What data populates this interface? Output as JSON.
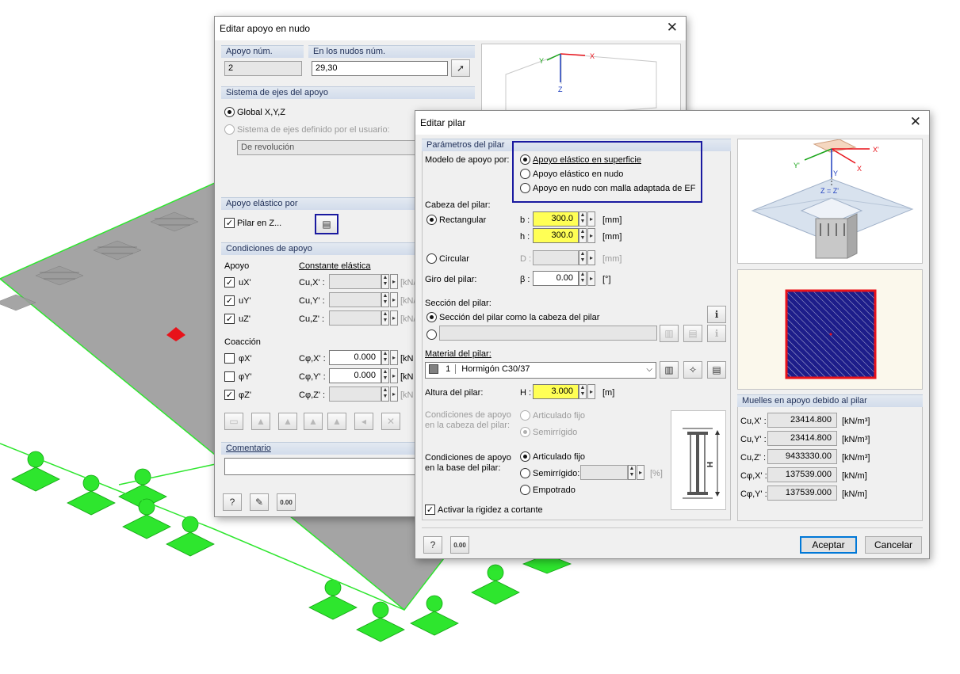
{
  "colors": {
    "accent": "#1a1aa0",
    "highlight_field": "#ffff55",
    "support_green": "#2ee62e",
    "plate_gray": "#a4a4a4",
    "section_fill": "#1d1d8a",
    "section_border": "#e8121a"
  },
  "back_dialog": {
    "title": "Editar apoyo en nudo",
    "support_no": {
      "label": "Apoyo núm.",
      "value": "2"
    },
    "nodes": {
      "label": "En los nudos núm.",
      "value": "29,30"
    },
    "axes_section": "Sistema de ejes del apoyo",
    "axes_global": "Global X,Y,Z",
    "axes_user": "Sistema de ejes definido por el usuario:",
    "axes_user_value": "De revolución",
    "elastic_section": "Apoyo elástico por",
    "column_in_z": "Pilar en Z...",
    "conditions_section": "Condiciones de apoyo",
    "col_support": "Apoyo",
    "col_elastic": "Constante elástica",
    "rows": [
      {
        "name": "uX'",
        "const": "Cu,X' :",
        "value": "",
        "unit": "[kN/"
      },
      {
        "name": "uY'",
        "const": "Cu,Y' :",
        "value": "",
        "unit": "[kN/"
      },
      {
        "name": "uZ'",
        "const": "Cu,Z' :",
        "value": "",
        "unit": "[kN/"
      }
    ],
    "restraint_label": "Coacción",
    "rot_rows": [
      {
        "name": "φX'",
        "const": "Cφ,X' :",
        "value": "0.000",
        "unit": "[kN"
      },
      {
        "name": "φY'",
        "const": "Cφ,Y' :",
        "value": "0.000",
        "unit": "[kN"
      },
      {
        "name": "φZ'",
        "const": "Cφ,Z' :",
        "value": "",
        "unit": "[kN"
      }
    ],
    "comment_label": "Comentario",
    "axis_labels": {
      "x": "X",
      "y": "Y",
      "z": "Z"
    }
  },
  "dialog": {
    "title": "Editar pilar",
    "params_section": "Parámetros del pilar",
    "model_label": "Modelo de apoyo por:",
    "model_options": [
      "Apoyo elástico en superficie",
      "Apoyo elástico en nudo",
      "Apoyo en nudo con malla adaptada de EF"
    ],
    "head_label": "Cabeza del pilar:",
    "rect_label": "Rectangular",
    "b_label": "b :",
    "b_value": "300.0",
    "h_label": "h :",
    "h_value": "300.0",
    "mm": "[mm]",
    "circ_label": "Circular",
    "d_label": "D :",
    "d_value": "",
    "rot_label": "Giro del pilar:",
    "beta_label": "β :",
    "beta_value": "0.00",
    "deg": "[°]",
    "sect_label": "Sección del pilar:",
    "sect_same": "Sección del pilar como la cabeza del pilar",
    "sect_custom_value": "",
    "material_label": "Material del pilar:",
    "material_no": "1",
    "material_value": "Hormigón C30/37",
    "height_label": "Altura del pilar:",
    "height_sym": "H :",
    "height_value": "3.000",
    "m_unit": "[m]",
    "head_cond_label": "Condiciones de apoyo en la cabeza del pilar:",
    "head_opt1": "Articulado fijo",
    "head_opt2": "Semirrígido",
    "base_cond_label": "Condiciones de apoyo en la base del pilar:",
    "base_opt1": "Articulado fijo",
    "base_opt2": "Semirrígido:",
    "base_opt3": "Empotrado",
    "base_semi_value": "",
    "pct": "[%]",
    "shear_label": "Activar la rigidez a cortante",
    "springs_section": "Muelles en apoyo debido al pilar",
    "springs": [
      {
        "label": "Cu,X' :",
        "value": "23414.800",
        "unit": "[kN/m³]"
      },
      {
        "label": "Cu,Y' :",
        "value": "23414.800",
        "unit": "[kN/m³]"
      },
      {
        "label": "Cu,Z' :",
        "value": "9433330.00",
        "unit": "[kN/m³]"
      },
      {
        "label": "Cφ,X' :",
        "value": "137539.000",
        "unit": "[kN/m]"
      },
      {
        "label": "Cφ,Y' :",
        "value": "137539.000",
        "unit": "[kN/m]"
      }
    ],
    "ok": "Aceptar",
    "cancel": "Cancelar",
    "preview_labels": {
      "x": "X",
      "x2": "X'",
      "y": "Y",
      "y2": "Y'",
      "z": "Z = Z'"
    },
    "diagram_h": "H"
  }
}
